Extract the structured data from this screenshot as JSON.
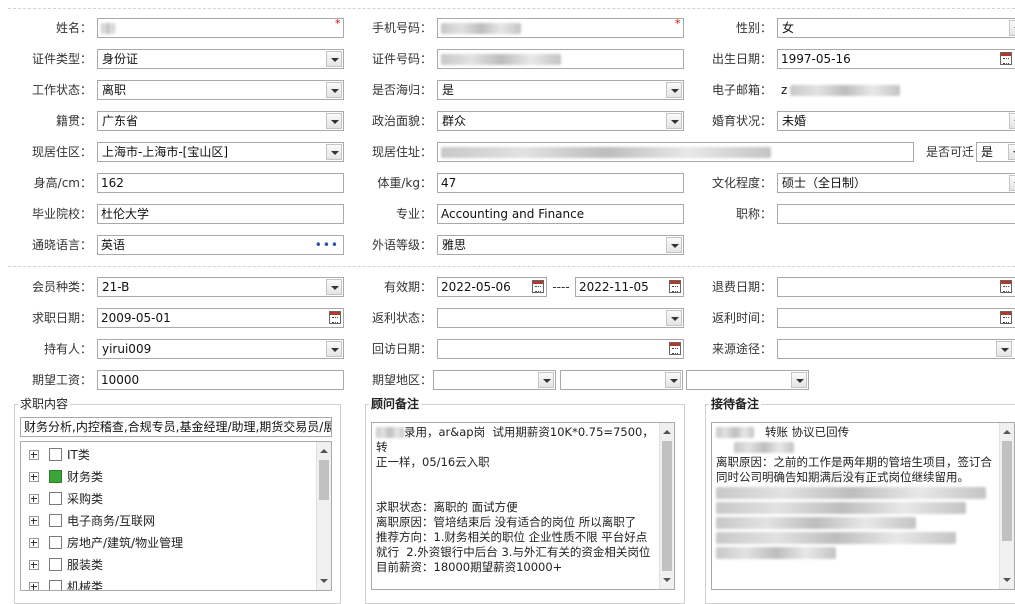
{
  "basic": {
    "name_label": "姓名：",
    "phone_label": "手机号码：",
    "gender_label": "性别：",
    "gender_value": "女",
    "id_type_label": "证件类型：",
    "id_type_value": "身份证",
    "id_no_label": "证件号码：",
    "birth_label": "出生日期：",
    "birth_value": "1997-05-16",
    "work_status_label": "工作状态：",
    "work_status_value": "离职",
    "returnee_label": "是否海归：",
    "returnee_value": "是",
    "email_label": "电子邮箱：",
    "email_value_prefix": "z",
    "native_label": "籍贯：",
    "native_value": "广东省",
    "political_label": "政治面貌：",
    "political_value": "群众",
    "marital_label": "婚育状况：",
    "marital_value": "未婚",
    "residence_label": "现居住区：",
    "residence_value": "上海市-上海市-[宝山区]",
    "address_label": "现居住址：",
    "relocate_label": "是否可迁",
    "relocate_value": "是",
    "height_label": "身高/cm：",
    "height_value": "162",
    "weight_label": "体重/kg：",
    "weight_value": "47",
    "education_label": "文化程度：",
    "education_value": "硕士（全日制）",
    "school_label": "毕业院校：",
    "school_value": "杜伦大学",
    "major_label": "专业：",
    "major_value": "Accounting and Finance",
    "title_label": "职称：",
    "title_value": "",
    "language_label": "通晓语言：",
    "language_value": "英语",
    "lang_level_label": "外语等级：",
    "lang_level_value": "雅思"
  },
  "member": {
    "type_label": "会员种类：",
    "type_value": "21-B",
    "valid_label": "有效期：",
    "valid_from": "2022-05-06",
    "valid_sep": "----",
    "valid_to": "2022-11-05",
    "refund_date_label": "退费日期：",
    "refund_date_value": "",
    "apply_date_label": "求职日期：",
    "apply_date_value": "2009-05-01",
    "rebate_status_label": "返利状态：",
    "rebate_status_value": "",
    "rebate_time_label": "返利时间：",
    "rebate_time_value": "",
    "holder_label": "持有人：",
    "holder_value": "yirui009",
    "visit_date_label": "回访日期：",
    "visit_date_value": "",
    "source_label": "来源途径：",
    "source_value": "",
    "salary_label": "期望工资：",
    "salary_value": "10000",
    "region_label": "期望地区："
  },
  "job": {
    "legend": "求职内容",
    "input_value": "财务分析,内控稽查,合规专员,基金经理/助理,期货交易员/展",
    "tree": [
      {
        "label": "IT类",
        "checked": false
      },
      {
        "label": "财务类",
        "checked": true
      },
      {
        "label": "采购类",
        "checked": false
      },
      {
        "label": "电子商务/互联网",
        "checked": false
      },
      {
        "label": "房地产/建筑/物业管理",
        "checked": false
      },
      {
        "label": "服装类",
        "checked": false
      },
      {
        "label": "机械类",
        "checked": false
      }
    ]
  },
  "advisor": {
    "legend": "顾问备注",
    "line1_suffix": "录用，ar&ap岗  试用期薪资10K*0.75=7500，转",
    "line2": "正一样，05/16云入职",
    "body": "求职状态：离职的 面试方便\n离职原因：管培结束后 没有适合的岗位 所以离职了\n推荐方向：1.财务相关的职位 企业性质不限 平台好点就行  2.外资银行中后台 3.与外汇有关的资金相关岗位\n目前薪资：18000期望薪资10000+"
  },
  "reception": {
    "legend": "接待备注",
    "line1_suffix": "转账 协议已回传",
    "body": "离职原因：之前的工作是两年期的管培生项目，签订合同时公司明确告知期满后没有正式岗位继续留用。"
  },
  "colors": {
    "required": "#dd0000",
    "checked": "#3aa63a",
    "border": "#a9a9a9"
  }
}
